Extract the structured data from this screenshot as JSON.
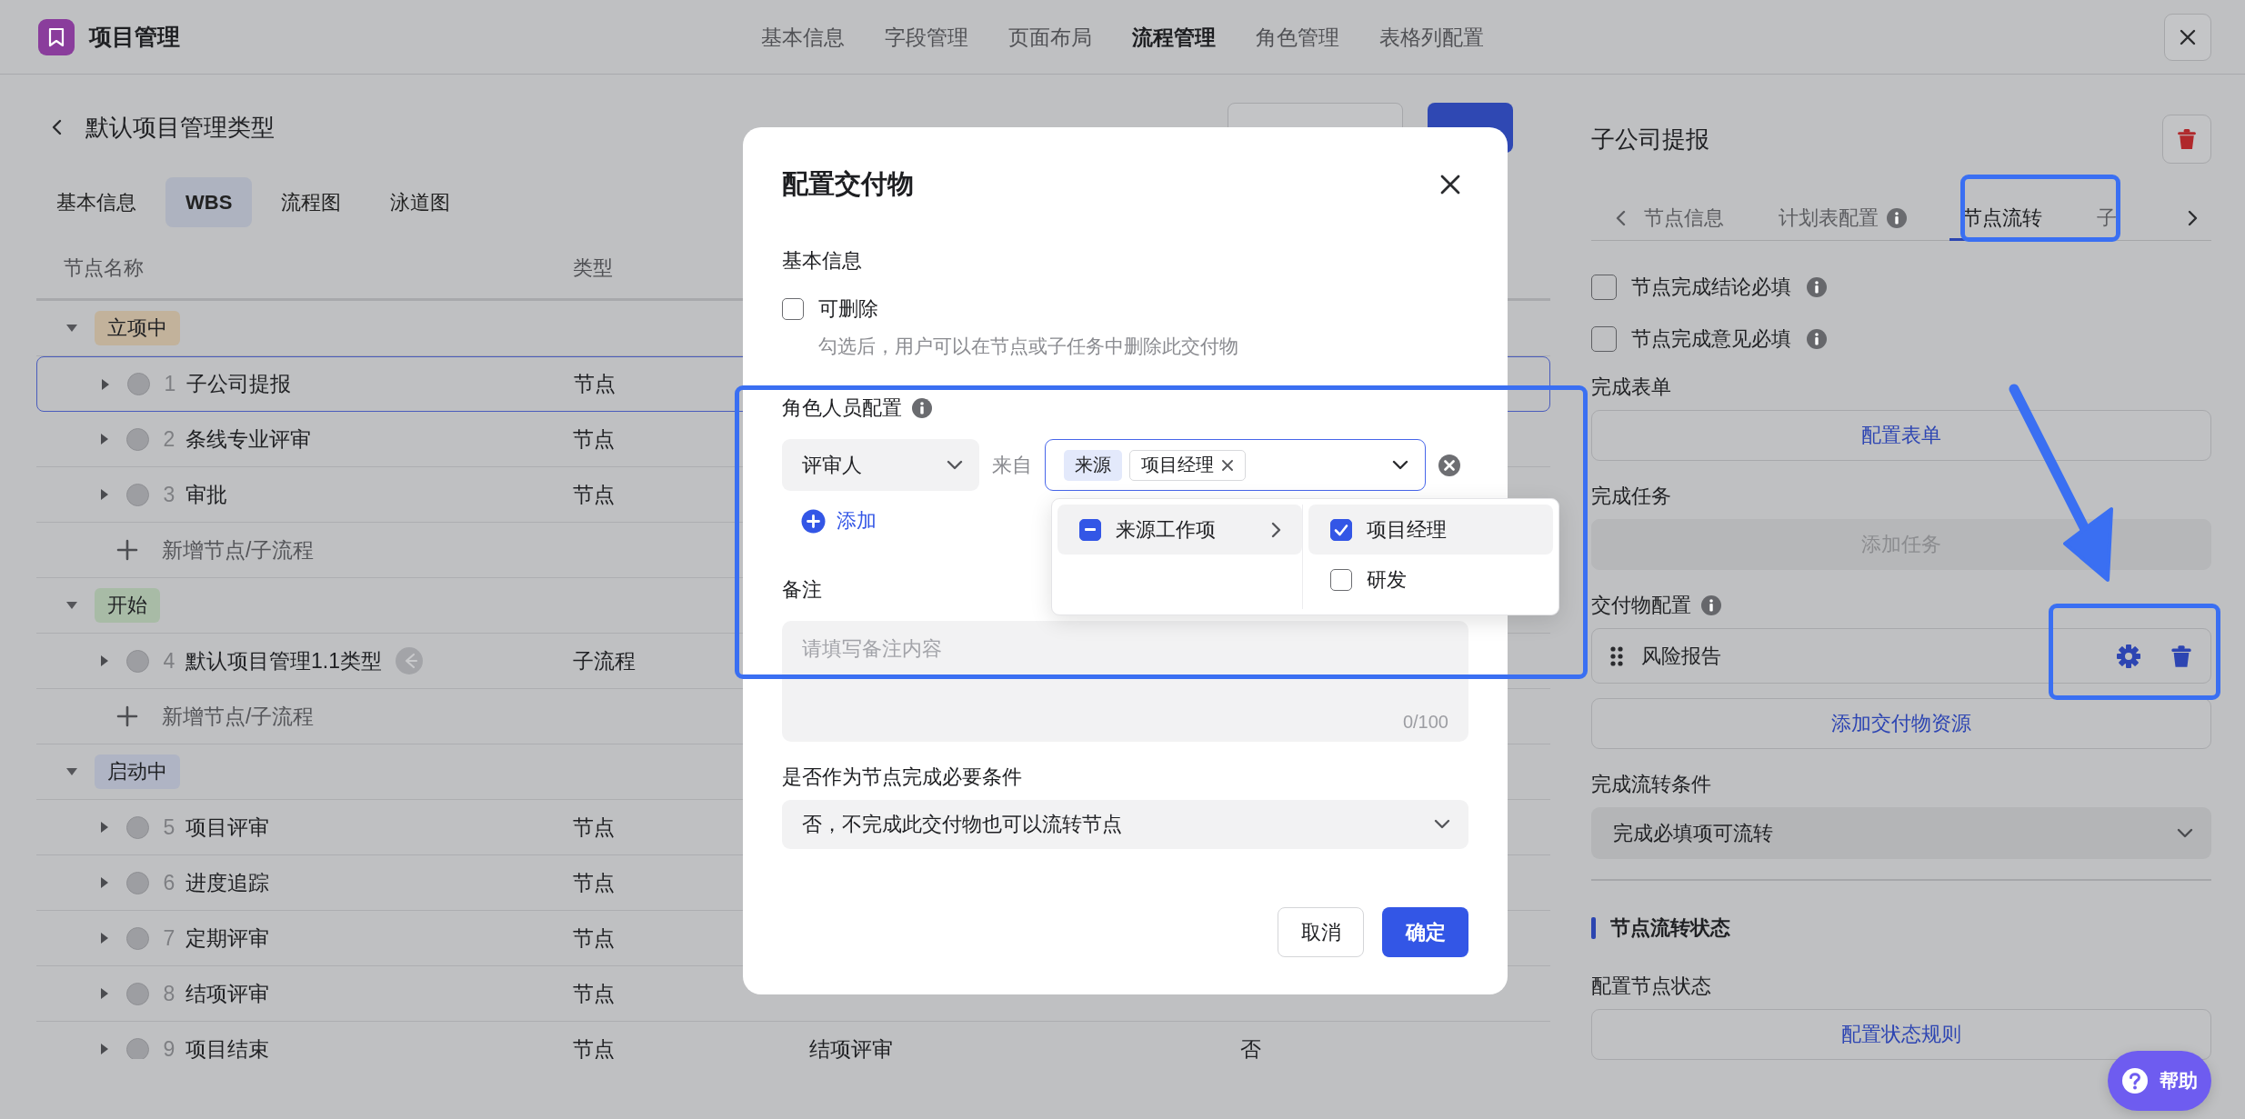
{
  "app": {
    "title": "项目管理"
  },
  "nav": [
    {
      "label": "基本信息",
      "selected": false
    },
    {
      "label": "字段管理",
      "selected": false
    },
    {
      "label": "页面布局",
      "selected": false
    },
    {
      "label": "流程管理",
      "selected": true
    },
    {
      "label": "角色管理",
      "selected": false
    },
    {
      "label": "表格列配置",
      "selected": false
    }
  ],
  "page": {
    "title": "默认项目管理类型",
    "actions": [
      {
        "kind": "secondary"
      },
      {
        "kind": "primary"
      }
    ],
    "tabs": [
      {
        "label": "基本信息",
        "selected": false
      },
      {
        "label": "WBS",
        "selected": true
      },
      {
        "label": "流程图",
        "selected": false
      },
      {
        "label": "泳道图",
        "selected": false
      }
    ],
    "table": {
      "columns": [
        "节点名称",
        "类型"
      ],
      "groups": [
        {
          "label": "立项中",
          "color": "#c2b29b",
          "expanded": true,
          "add_label": "新增节点/子流程",
          "rows": [
            {
              "index": "1",
              "name": "子公司提报",
              "type": "节点",
              "selected": true
            },
            {
              "index": "2",
              "name": "条线专业评审",
              "type": "节点",
              "selected": false
            },
            {
              "index": "3",
              "name": "审批",
              "type": "节点",
              "selected": false
            }
          ]
        },
        {
          "label": "开始",
          "color": "#a8bba6",
          "expanded": true,
          "add_label": "新增节点/子流程",
          "rows": [
            {
              "index": "4",
              "name": "默认项目管理1.1类型",
              "type": "子流程",
              "selected": false,
              "subflow_mark": true
            }
          ]
        },
        {
          "label": "启动中",
          "color": "#afb4c4",
          "expanded": true,
          "rows": [
            {
              "index": "5",
              "name": "项目评审",
              "type": "节点",
              "selected": false
            },
            {
              "index": "6",
              "name": "进度追踪",
              "type": "节点",
              "selected": false
            },
            {
              "index": "7",
              "name": "定期评审",
              "type": "节点",
              "selected": false
            },
            {
              "index": "8",
              "name": "结项评审",
              "type": "节点",
              "selected": false
            },
            {
              "index": "9",
              "name": "项目结束",
              "type": "节点",
              "selected": false,
              "column_3": "结项评审",
              "column_5": "否"
            }
          ]
        }
      ]
    }
  },
  "side": {
    "title": "子公司提报",
    "tabs": [
      {
        "label": "节点信息",
        "selected": false
      },
      {
        "label": "计划表配置",
        "selected": false,
        "info": true
      },
      {
        "label": "节点流转",
        "selected": true
      },
      {
        "label": "子",
        "selected": false
      }
    ],
    "items": [
      {
        "kind": "checkbox",
        "label": "节点完成结论必填",
        "checked": false,
        "info": true
      },
      {
        "kind": "checkbox",
        "label": "节点完成意见必填",
        "checked": false,
        "info": true
      },
      {
        "kind": "label",
        "text": "完成表单"
      },
      {
        "kind": "button",
        "label": "配置表单",
        "disabled": false
      },
      {
        "kind": "label",
        "text": "完成任务"
      },
      {
        "kind": "button",
        "label": "添加任务",
        "disabled": true
      },
      {
        "kind": "label",
        "text": "交付物配置",
        "info": true
      },
      {
        "kind": "deliverable",
        "name": "风险报告"
      },
      {
        "kind": "button",
        "label": "添加交付物资源",
        "disabled": false
      },
      {
        "kind": "label",
        "text": "完成流转条件"
      },
      {
        "kind": "select",
        "value": "完成必填项可流转"
      },
      {
        "kind": "divider"
      },
      {
        "kind": "heading",
        "text": "节点流转状态"
      },
      {
        "kind": "label",
        "text": "配置节点状态"
      },
      {
        "kind": "button",
        "label": "配置状态规则",
        "disabled": false
      }
    ]
  },
  "modal": {
    "title": "配置交付物",
    "basic_label": "基本信息",
    "deletable": {
      "label": "可删除",
      "checked": false,
      "hint": "勾选后，用户可以在节点或子任务中删除此交付物"
    },
    "role_label": "角色人员配置",
    "role_row": {
      "role": "评审人",
      "from_label": "来自",
      "tags": [
        {
          "label": "来源",
          "kind": "source"
        },
        {
          "label": "项目经理",
          "kind": "value"
        }
      ]
    },
    "add_label": "添加",
    "dropdown": {
      "left": [
        {
          "label": "来源工作项",
          "indeterminate": true,
          "selected": true
        }
      ],
      "right": [
        {
          "label": "项目经理",
          "checked": true,
          "selected": true
        },
        {
          "label": "研发",
          "checked": false,
          "selected": false
        }
      ]
    },
    "note_label": "备注",
    "note": {
      "placeholder": "请填写备注内容",
      "count": "0/100"
    },
    "required_label": "是否作为节点完成必要条件",
    "required_value": "否，不完成此交付物也可以流转节点",
    "buttons": [
      {
        "label": "取消",
        "kind": "secondary"
      },
      {
        "label": "确定",
        "kind": "primary"
      }
    ]
  },
  "help": {
    "label": "帮助"
  }
}
